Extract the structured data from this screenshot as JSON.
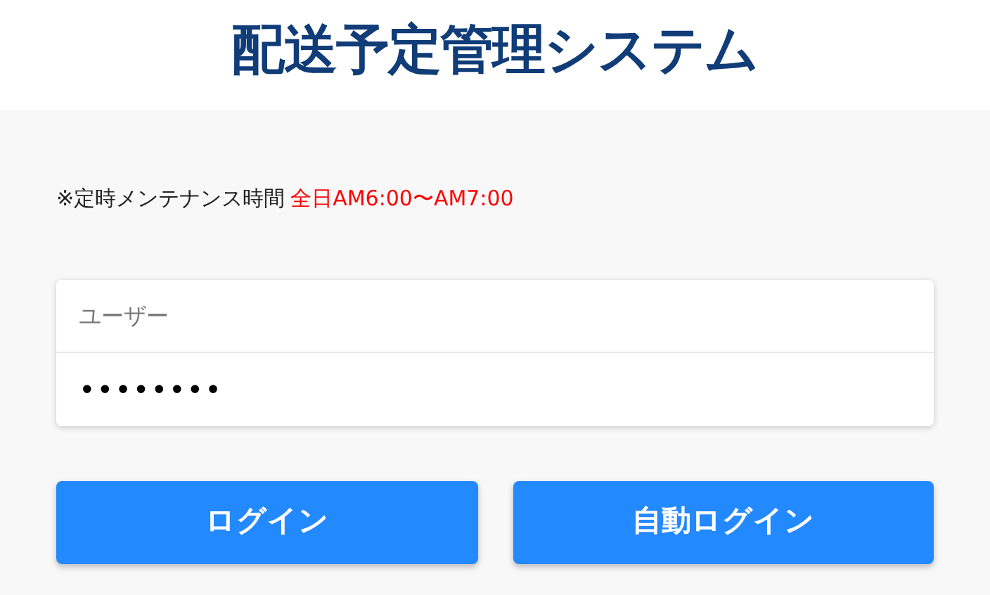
{
  "title": "配送予定管理システム",
  "notice": {
    "label": "※定時メンテナンス時間",
    "time": "全日AM6:00〜AM7:00"
  },
  "fields": [
    {
      "kind": "text",
      "placeholder": "ユーザー"
    },
    {
      "kind": "password",
      "value": "••••••••"
    }
  ],
  "buttons": [
    "ログイン",
    "自動ログイン"
  ]
}
